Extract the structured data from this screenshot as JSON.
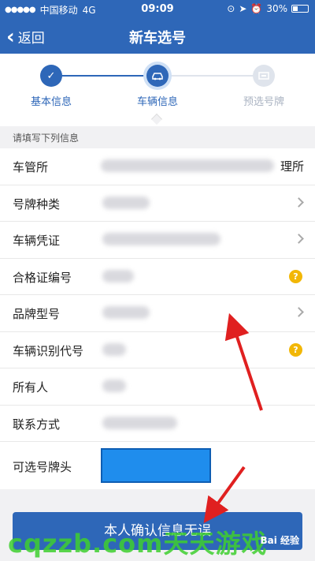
{
  "status": {
    "carrier": "中国移动",
    "network": "4G",
    "time": "09:09",
    "battery": "30%"
  },
  "nav": {
    "back_label": "返回",
    "title": "新车选号"
  },
  "steps": [
    {
      "label": "基本信息",
      "state": "done"
    },
    {
      "label": "车辆信息",
      "state": "current"
    },
    {
      "label": "预选号牌",
      "state": "pending"
    }
  ],
  "hint": "请填写下列信息",
  "form": {
    "rows": [
      {
        "label": "车管所",
        "trail": "理所"
      },
      {
        "label": "号牌种类"
      },
      {
        "label": "车辆凭证"
      },
      {
        "label": "合格证编号"
      },
      {
        "label": "品牌型号"
      },
      {
        "label": "车辆识别代号"
      },
      {
        "label": "所有人"
      },
      {
        "label": "联系方式"
      },
      {
        "label": "可选号牌头"
      }
    ]
  },
  "confirm_label": "本人确认信息无误",
  "watermark": "cqzzb.com天天游戏",
  "baidu_mark": "Bai 经验",
  "colors": {
    "primary": "#2e67b8",
    "help": "#f2b705",
    "highlight": "#1f8ded",
    "arrow": "#e02020",
    "watermark": "#3fcf2f"
  }
}
